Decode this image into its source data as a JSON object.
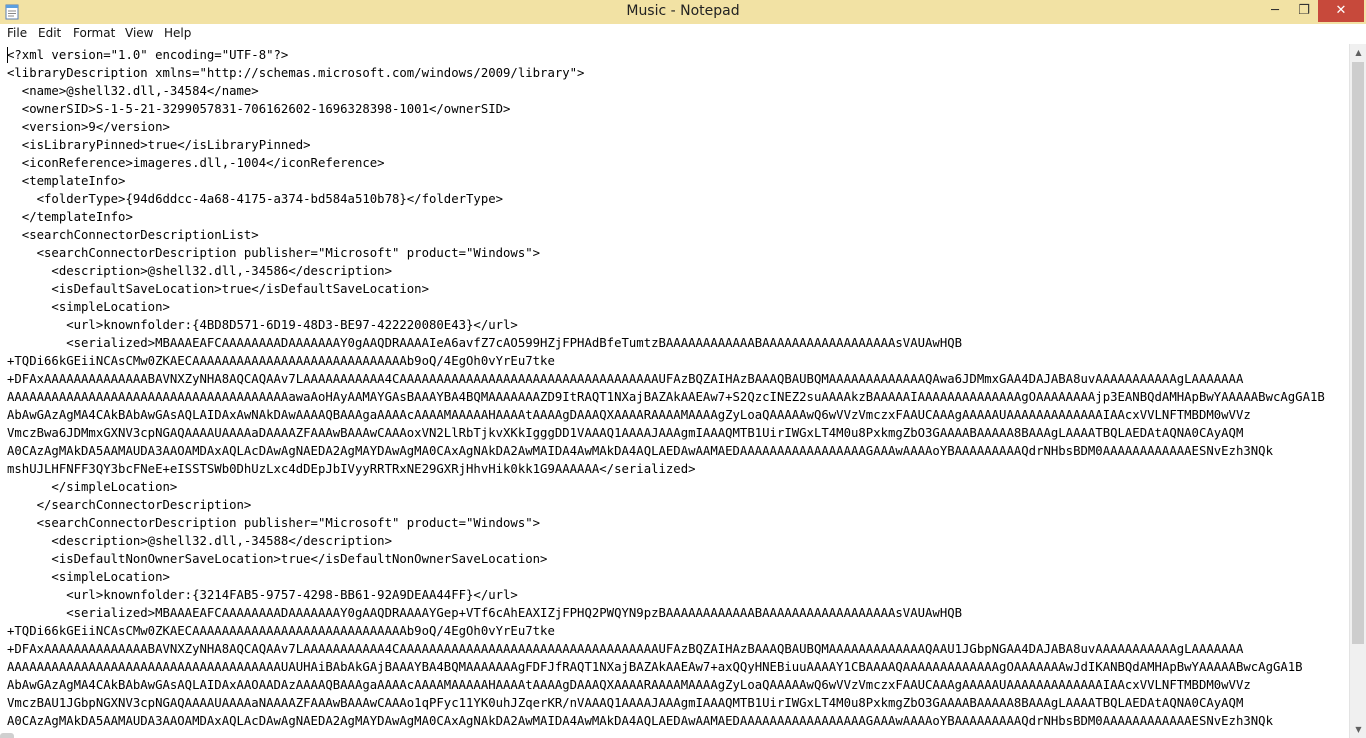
{
  "window": {
    "title": "Music - Notepad",
    "controls": {
      "minimize": "─",
      "maximize": "❐",
      "close": "✕"
    }
  },
  "menu": {
    "items": [
      "File",
      "Edit",
      "Format",
      "View",
      "Help"
    ]
  },
  "editor": {
    "lines": [
      "<?xml version=\"1.0\" encoding=\"UTF-8\"?>",
      "<libraryDescription xmlns=\"http://schemas.microsoft.com/windows/2009/library\">",
      "  <name>@shell32.dll,-34584</name>",
      "  <ownerSID>S-1-5-21-3299057831-706162602-1696328398-1001</ownerSID>",
      "  <version>9</version>",
      "  <isLibraryPinned>true</isLibraryPinned>",
      "  <iconReference>imageres.dll,-1004</iconReference>",
      "  <templateInfo>",
      "    <folderType>{94d6ddcc-4a68-4175-a374-bd584a510b78}</folderType>",
      "  </templateInfo>",
      "  <searchConnectorDescriptionList>",
      "    <searchConnectorDescription publisher=\"Microsoft\" product=\"Windows\">",
      "      <description>@shell32.dll,-34586</description>",
      "      <isDefaultSaveLocation>true</isDefaultSaveLocation>",
      "      <simpleLocation>",
      "        <url>knownfolder:{4BD8D571-6D19-48D3-BE97-422220080E43}</url>",
      "        <serialized>MBAAAEAFCAAAAAAAADAAAAAAAY0gAAQDRAAAAIeA6avfZ7cAO599HZjFPHAdBfeTumtzBAAAAAAAAAAAABAAAAAAAAAAAAAAAAAAsVAUAwHQB",
      "+TQDi66kGEiiNCAsCMw0ZKAECAAAAAAAAAAAAAAAAAAAAAAAAAAAAAb9oQ/4EgOh0vYrEu7tke",
      "+DFAxAAAAAAAAAAAAAABAVNXZyNHA8AQCAQAAv7LAAAAAAAAAAA4CAAAAAAAAAAAAAAAAAAAAAAAAAAAAAAAAAAAUFAzBQZAIHAzBAAAQBAUBQMAAAAAAAAAAAAAQAwa6JDMmxGAA4DAJABA8uvAAAAAAAAAAAgLAAAAAAA",
      "AAAAAAAAAAAAAAAAAAAAAAAAAAAAAAAAAAAAAAawaAoHAyAAMAYGAsBAAAYBA4BQMAAAAAAAZD9ItRAQT1NXajBAZAkAAEAw7+S2QzcINEZ2suAAAAkzBAAAAAIAAAAAAAAAAAAAAgOAAAAAAAAjp3EANBQdAMHApBwYAAAAABwcAgGA1B",
      "AbAwGAzAgMA4CAkBAbAwGAsAQLAIDAxAwNAkDAwAAAAQBAAAgaAAAAcAAAAMAAAAAHAAAAtAAAAgDAAAQXAAAARAAAAMAAAAgZyLoaQAAAAAwQ6wVVzVmczxFAAUCAAAgAAAAAUAAAAAAAAAAAAAIAAcxVVLNFTMBDM0wVVz",
      "VmczBwa6JDMmxGXNV3cpNGAQAAAAUAAAAaDAAAAZFAAAwBAAAwCAAAoxVN2LlRbTjkvXKkIgggDD1VAAAQ1AAAAJAAAgmIAAAQMTB1UirIWGxLT4M0u8PxkmgZbO3GAAAABAAAAA8BAAAgLAAAATBQLAEDAtAQNA0CAyAQM",
      "A0CAzAgMAkDA5AAMAUDA3AAOAMDAxAQLAcDAwAgNAEDA2AgMAYDAwAgMA0CAxAgNAkDA2AwMAIDA4AwMAkDA4AQLAEDAwAAMAEDAAAAAAAAAAAAAAAAAGAAAwAAAAoYBAAAAAAAAAQdrNHbsBDM0AAAAAAAAAAAAESNvEzh3NQk",
      "mshUJLHFNFF3QY3bcFNeE+eISSTSWb0DhUzLxc4dDEpJbIVyyRRTRxNE29GXRjHhvHik0kk1G9AAAAAA</serialized>",
      "      </simpleLocation>",
      "    </searchConnectorDescription>",
      "    <searchConnectorDescription publisher=\"Microsoft\" product=\"Windows\">",
      "      <description>@shell32.dll,-34588</description>",
      "      <isDefaultNonOwnerSaveLocation>true</isDefaultNonOwnerSaveLocation>",
      "      <simpleLocation>",
      "        <url>knownfolder:{3214FAB5-9757-4298-BB61-92A9DEAA44FF}</url>",
      "        <serialized>MBAAAEAFCAAAAAAAADAAAAAAAY0gAAQDRAAAAYGep+VTf6cAhEAXIZjFPHQ2PWQYN9pzBAAAAAAAAAAAABAAAAAAAAAAAAAAAAAAsVAUAwHQB",
      "+TQDi66kGEiiNCAsCMw0ZKAECAAAAAAAAAAAAAAAAAAAAAAAAAAAAAb9oQ/4EgOh0vYrEu7tke",
      "+DFAxAAAAAAAAAAAAAABAVNXZyNHA8AQCAQAAv7LAAAAAAAAAAA4CAAAAAAAAAAAAAAAAAAAAAAAAAAAAAAAAAAAUFAzBQZAIHAzBAAAQBAUBQMAAAAAAAAAAAAAQAAU1JGbpNGAA4DAJABA8uvAAAAAAAAAAAgLAAAAAAA",
      "AAAAAAAAAAAAAAAAAAAAAAAAAAAAAAAAAAAAAUAUHAiBAbAkGAjBAAAYBA4BQMAAAAAAAgFDFJfRAQT1NXajBAZAkAAEAw7+axQQyHNEBiuuAAAAY1CBAAAAQAAAAAAAAAAAAAgOAAAAAAAwJdIKANBQdAMHApBwYAAAAABwcAgGA1B",
      "AbAwGAzAgMA4CAkBAbAwGAsAQLAIDAxAAOAADAzAAAAQBAAAgaAAAAcAAAAMAAAAAHAAAAtAAAAgDAAAQXAAAARAAAAMAAAAgZyLoaQAAAAAwQ6wVVzVmczxFAAUCAAAgAAAAAUAAAAAAAAAAAAAIAAcxVVLNFTMBDM0wVVz",
      "VmczBAU1JGbpNGXNV3cpNGAQAAAAUAAAAaNAAAAZFAAAwBAAAwCAAAo1qPFyc11YK0uhJZqerKR/nVAAAQ1AAAAJAAAgmIAAAQMTB1UirIWGxLT4M0u8PxkmgZbO3GAAAABAAAAA8BAAAgLAAAATBQLAEDAtAQNA0CAyAQM",
      "A0CAzAgMAkDA5AAMAUDA3AAOAMDAxAQLAcDAwAgNAEDA2AgMAYDAwAgMA0CAxAgNAkDA2AwMAIDA4AwMAkDA4AQLAEDAwAAMAEDAAAAAAAAAAAAAAAAAGAAAwAAAAoYBAAAAAAAAAQdrNHbsBDM0AAAAAAAAAAAAESNvEzh3NQk"
    ]
  },
  "scrollbar": {
    "up_arrow": "▲",
    "down_arrow": "▼"
  }
}
